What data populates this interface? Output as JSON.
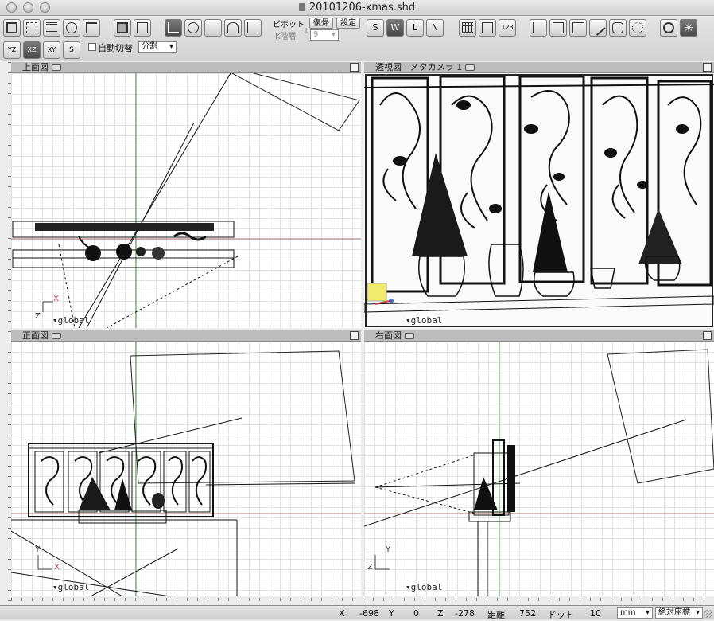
{
  "window": {
    "title": "20101206-xmas.shd"
  },
  "toolbar": {
    "pivot_label": "ピボット",
    "ik_label": "IK階層",
    "ik_value": "9",
    "restore_button": "復帰",
    "settings_button": "設定",
    "auto_switch_label": "自動切替",
    "split_value": "分割",
    "plane_buttons": [
      "YZ",
      "XZ",
      "XY",
      "S"
    ],
    "mode_icons": [
      "object-mode-icon",
      "point-mode-icon",
      "layers-icon",
      "snap-icon",
      "link-icon"
    ],
    "view_icons": [
      "shaded-icon",
      "wire-icon"
    ],
    "transform_icons": [
      "move-icon",
      "rotate-icon",
      "scale-icon",
      "joint-icon",
      "axis-icon"
    ],
    "snap_letters": [
      "S",
      "W",
      "L",
      "N"
    ],
    "right_icons": [
      "grid-icon",
      "window-icon",
      "numeric-icon",
      "measure-icon",
      "copy-icon",
      "align-icon",
      "line-icon",
      "bridge-icon",
      "bones-icon",
      "render-icon",
      "star-icon"
    ],
    "numeric_label": "123"
  },
  "viewports": {
    "top": {
      "label": "上面図",
      "global": "global",
      "axis_h": "X",
      "axis_v": "Z"
    },
    "perspective": {
      "label": "透視図 : メタカメラ 1",
      "global": "global"
    },
    "front": {
      "label": "正面図",
      "global": "global",
      "axis_h": "X",
      "axis_v": "Y"
    },
    "right": {
      "label": "右面図",
      "global": "global",
      "axis_h": "Z",
      "axis_v": "Y"
    }
  },
  "status": {
    "x_label": "X",
    "x_value": "-698",
    "y_label": "Y",
    "y_value": "0",
    "z_label": "Z",
    "z_value": "-278",
    "distance_label": "距離",
    "distance_value": "752",
    "dot_label": "ドット",
    "dot_value": "10",
    "unit_value": "mm",
    "coord_mode_value": "絶対座標"
  }
}
